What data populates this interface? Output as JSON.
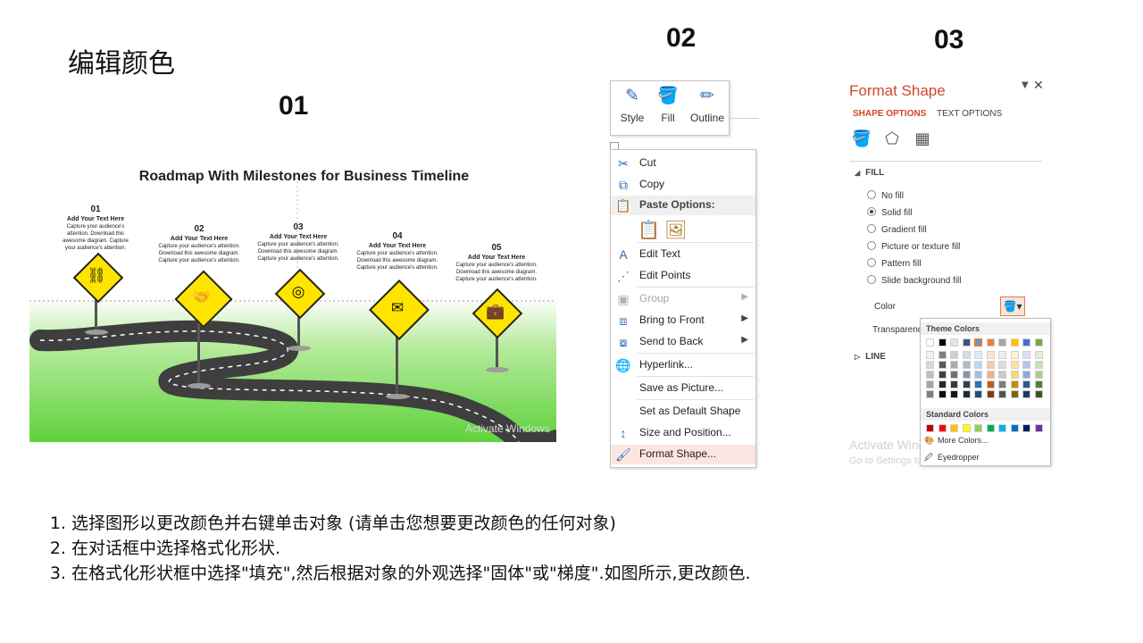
{
  "page": {
    "title": "编辑颜色",
    "steps": [
      "01",
      "02",
      "03"
    ]
  },
  "slide": {
    "title": "Roadmap With Milestones for Business Timeline",
    "watermark": "Activate Windows",
    "colors": {
      "sign": "#ffe400",
      "grass": "#5fd23c",
      "road": "#3e3e3e"
    },
    "milestones": [
      {
        "num": "01",
        "heading": "Add Your Text Here",
        "body": "Capture your audience's attention. Download this awesome diagram. Capture your audience's attention.",
        "icon": "chain-icon"
      },
      {
        "num": "02",
        "heading": "Add Your Text Here",
        "body": "Capture your audience's attention. Download this awesome diagram. Capture your audience's attention.",
        "icon": "handshake-icon"
      },
      {
        "num": "03",
        "heading": "Add Your Text Here",
        "body": "Capture your audience's attention. Download this awesome diagram. Capture your audience's attention.",
        "icon": "target-icon"
      },
      {
        "num": "04",
        "heading": "Add Your Text Here",
        "body": "Capture your audience's attention. Download this awesome diagram. Capture your audience's attention.",
        "icon": "envelope-icon"
      },
      {
        "num": "05",
        "heading": "Add Your Text Here",
        "body": "Capture your audience's attention. Download this awesome diagram. Capture your audience's attention.",
        "icon": "briefcase-icon"
      }
    ]
  },
  "mini_toolbar": {
    "buttons": [
      {
        "label": "Style",
        "icon": "style-icon"
      },
      {
        "label": "Fill",
        "icon": "fill-bucket-icon"
      },
      {
        "label": "Outline",
        "icon": "outline-pen-icon"
      }
    ]
  },
  "context_menu": {
    "items": [
      {
        "label": "Cut",
        "icon": "scissors-icon",
        "enabled": true
      },
      {
        "label": "Copy",
        "icon": "copy-icon",
        "enabled": true
      },
      {
        "label": "Paste Options:",
        "icon": "paste-icon",
        "enabled": true
      },
      {
        "label": "Edit Text",
        "icon": "edit-text-icon",
        "enabled": true
      },
      {
        "label": "Edit Points",
        "icon": "edit-points-icon",
        "enabled": true
      },
      {
        "label": "Group",
        "icon": "group-icon",
        "enabled": false,
        "submenu": true
      },
      {
        "label": "Bring to Front",
        "icon": "bring-front-icon",
        "enabled": true,
        "submenu": true
      },
      {
        "label": "Send to Back",
        "icon": "send-back-icon",
        "enabled": true,
        "submenu": true
      },
      {
        "label": "Hyperlink...",
        "icon": "hyperlink-icon",
        "enabled": true
      },
      {
        "label": "Save as Picture...",
        "enabled": true
      },
      {
        "label": "Set as Default Shape",
        "enabled": true
      },
      {
        "label": "Size and Position...",
        "icon": "size-position-icon",
        "enabled": true
      },
      {
        "label": "Format Shape...",
        "icon": "format-shape-icon",
        "enabled": true,
        "highlighted": true
      }
    ]
  },
  "format_pane": {
    "title": "Format Shape",
    "tabs": [
      "SHAPE OPTIONS",
      "TEXT OPTIONS"
    ],
    "active_tab": "SHAPE OPTIONS",
    "accent_color": "#d24726",
    "fill_section": "FILL",
    "line_section": "LINE",
    "fill_options": [
      "No fill",
      "Solid fill",
      "Gradient fill",
      "Picture or texture fill",
      "Pattern fill",
      "Slide background fill"
    ],
    "selected_fill": "Solid fill",
    "color_label": "Color",
    "transparency_label": "Transparency",
    "watermark": "Activate Windows",
    "watermark_sub": "Go to Settings to activate Windows."
  },
  "color_popup": {
    "theme_header": "Theme Colors",
    "standard_header": "Standard Colors",
    "more_colors": "More Colors...",
    "eyedropper": "Eyedropper",
    "theme_base": [
      "#ffffff",
      "#000000",
      "#e7e6e6",
      "#44546a",
      "#5b9bd5",
      "#ed7d31",
      "#a5a5a5",
      "#ffc000",
      "#4472c4",
      "#70ad47"
    ],
    "theme_shades": [
      [
        "#f2f2f2",
        "#7f7f7f",
        "#d0cece",
        "#d6dce4",
        "#deebf6",
        "#fbe5d5",
        "#ededed",
        "#fff2cc",
        "#dae3f3",
        "#e2efd9"
      ],
      [
        "#d8d8d8",
        "#595959",
        "#aeabab",
        "#adb9ca",
        "#bdd7ee",
        "#f7cbac",
        "#dbdbdb",
        "#fee599",
        "#b4c6e7",
        "#c5e0b3"
      ],
      [
        "#bfbfbf",
        "#3f3f3f",
        "#757070",
        "#8496b0",
        "#9cc3e5",
        "#f4b183",
        "#c9c9c9",
        "#ffd965",
        "#8eaadb",
        "#a8d08d"
      ],
      [
        "#a5a5a5",
        "#262626",
        "#3a3838",
        "#323f4f",
        "#2e75b5",
        "#c55a11",
        "#7b7b7b",
        "#bf9000",
        "#2f5496",
        "#538135"
      ],
      [
        "#7f7f7f",
        "#0c0c0c",
        "#171616",
        "#222a35",
        "#1e4e79",
        "#833c0b",
        "#525252",
        "#7f6000",
        "#1f3864",
        "#375623"
      ]
    ],
    "standard": [
      "#c00000",
      "#ff0000",
      "#ffc000",
      "#ffff00",
      "#92d050",
      "#00b050",
      "#00b0f0",
      "#0070c0",
      "#002060",
      "#7030a0"
    ],
    "selected_theme_index": 4
  },
  "instructions": [
    "选择图形以更改颜色并右键单击对象 (请单击您想要更改颜色的任何对象)",
    "在对话框中选择格式化形状.",
    "在格式化形状框中选择\"填充\",然后根据对象的外观选择\"固体\"或\"梯度\".如图所示,更改颜色."
  ]
}
